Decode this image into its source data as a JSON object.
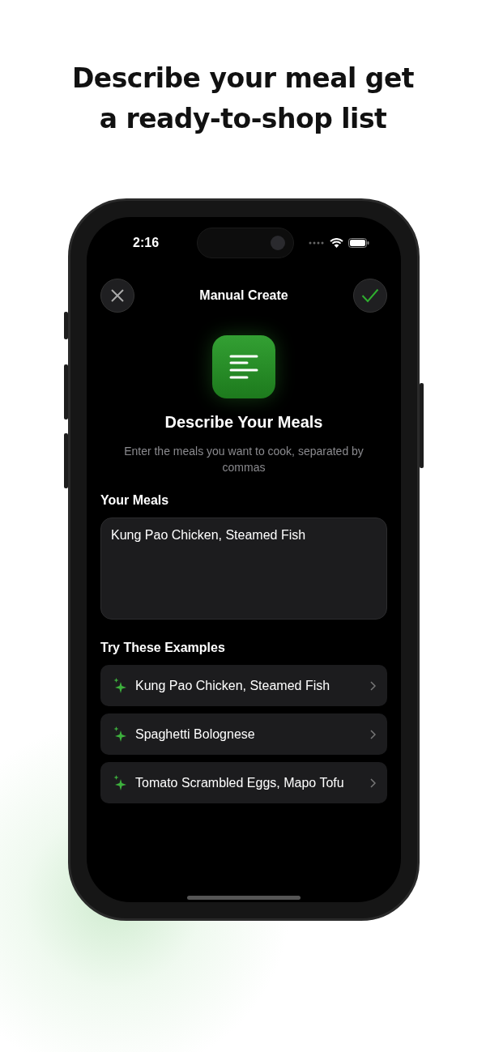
{
  "headline": "Describe your meal get a ready-to-shop list",
  "status_bar": {
    "time": "2:16"
  },
  "nav": {
    "title": "Manual Create"
  },
  "hero": {
    "title": "Describe Your Meals",
    "subtitle": "Enter the meals you want to cook, separated by commas"
  },
  "meals": {
    "label": "Your Meals",
    "value": "Kung Pao Chicken, Steamed Fish"
  },
  "examples": {
    "title": "Try These Examples",
    "items": [
      {
        "label": "Kung Pao Chicken, Steamed Fish"
      },
      {
        "label": "Spaghetti Bolognese"
      },
      {
        "label": "Tomato Scrambled Eggs, Mapo Tofu"
      }
    ]
  }
}
